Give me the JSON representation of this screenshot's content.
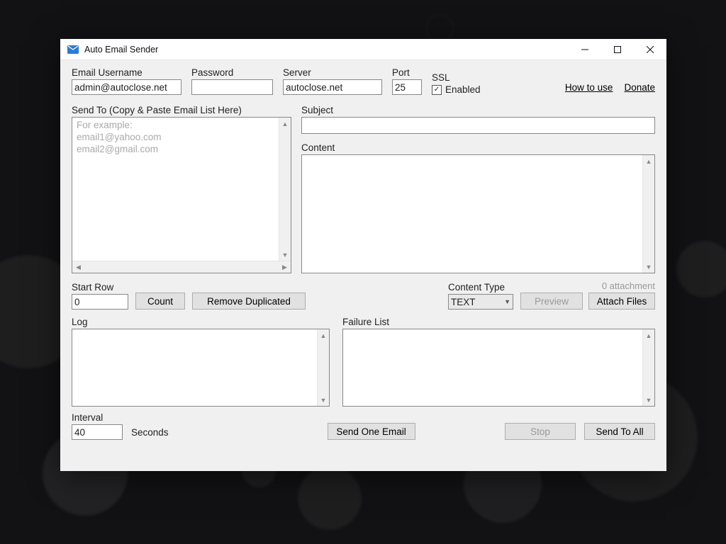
{
  "window": {
    "title": "Auto Email Sender"
  },
  "labels": {
    "username": "Email Username",
    "password": "Password",
    "server": "Server",
    "port": "Port",
    "ssl": "SSL",
    "ssl_enabled": "Enabled",
    "how_to_use": "How to use",
    "donate": "Donate",
    "send_to": "Send To (Copy & Paste Email List Here)",
    "subject": "Subject",
    "content": "Content",
    "start_row": "Start Row",
    "count": "Count",
    "remove_dup": "Remove Duplicated",
    "content_type": "Content Type",
    "preview": "Preview",
    "attach_files": "Attach Files",
    "attach_count": "0 attachment",
    "log": "Log",
    "failure": "Failure List",
    "interval": "Interval",
    "seconds": "Seconds",
    "send_one": "Send One Email",
    "stop": "Stop",
    "send_all": "Send To All"
  },
  "values": {
    "username": "admin@autoclose.net",
    "password": "",
    "server": "autoclose.net",
    "port": "25",
    "ssl_checked": true,
    "send_to": "",
    "send_to_placeholder": "For example:\nemail1@yahoo.com\nemail2@gmail.com",
    "subject": "",
    "content": "",
    "start_row": "0",
    "content_type": "TEXT",
    "interval": "40"
  }
}
